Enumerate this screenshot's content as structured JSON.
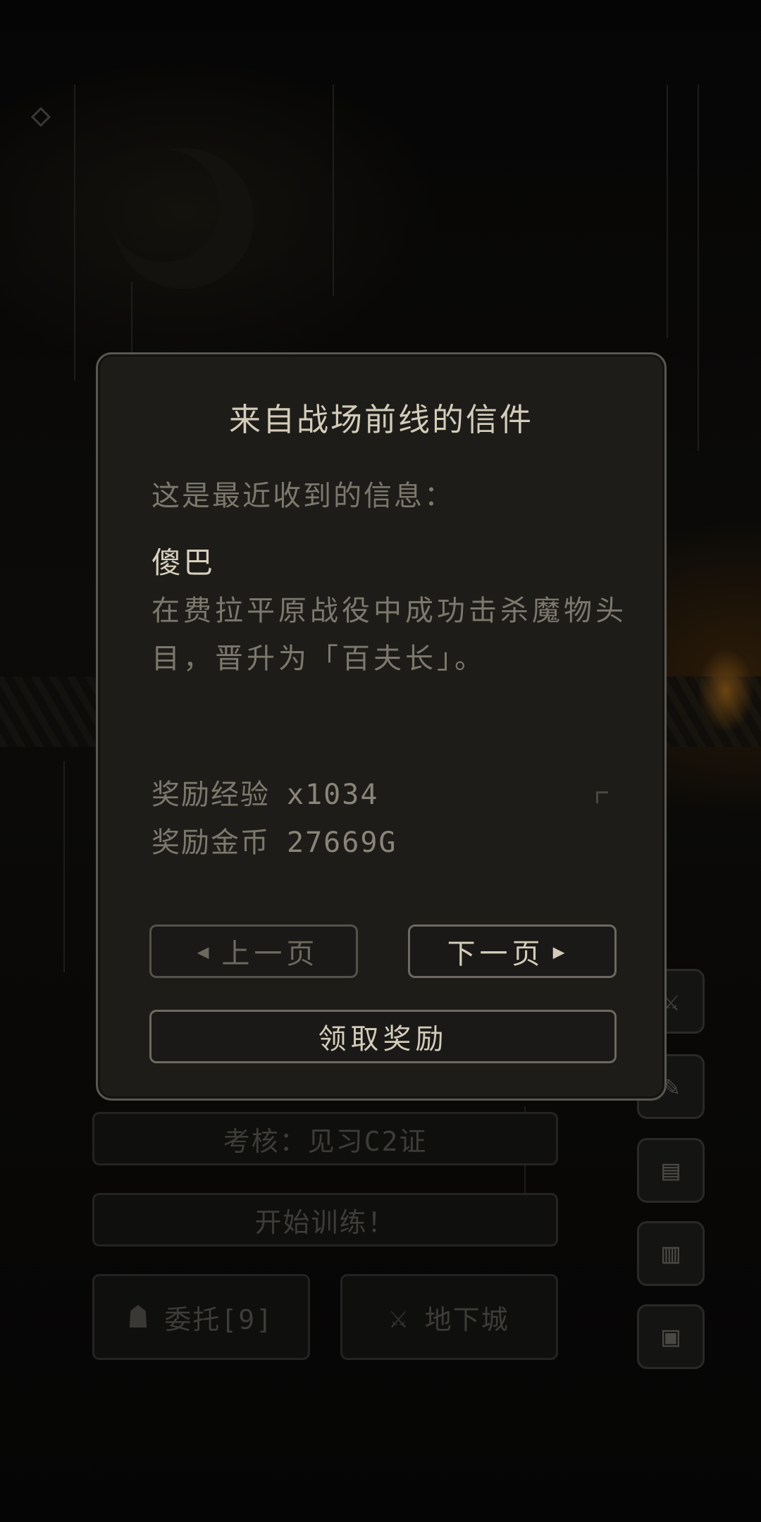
{
  "dialog": {
    "title": "来自战场前线的信件",
    "intro": "这是最近收到的信息：",
    "sender": "傻巴",
    "message": "在费拉平原战役中成功击杀魔物头目，晋升为「百夫长」。",
    "rewards": [
      {
        "label": "奖励经验",
        "value": "x1034"
      },
      {
        "label": "奖励金币",
        "value": "27669G"
      }
    ],
    "prev_label": "上一页",
    "next_label": "下一页",
    "claim_label": "领取奖励"
  },
  "background_menu": {
    "exam_label": "考核：见习C2证",
    "train_label": "开始训练！",
    "commission_label": "委托[9]",
    "dungeon_label": "地下城"
  },
  "icons": {
    "prev": "left-triangle-icon",
    "next": "right-triangle-icon",
    "commission": "hooded-figure-icon",
    "dungeon": "sword-icon",
    "side": [
      "sword-icon",
      "quill-icon",
      "scroll-icon",
      "book-icon",
      "computer-icon"
    ]
  }
}
